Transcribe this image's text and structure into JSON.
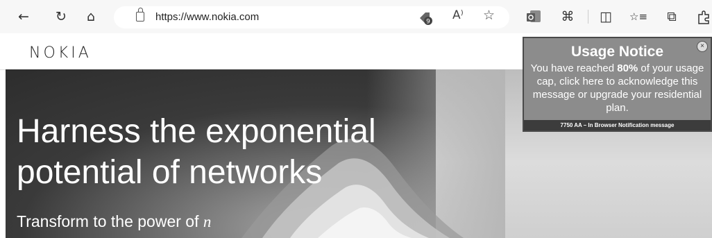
{
  "browser": {
    "url": "https://www.nokia.com",
    "icons": [
      "back-arrow-icon",
      "refresh-icon",
      "home-icon",
      "site-info-icon",
      "extension-icon",
      "read-aloud-icon",
      "favorite-star-icon",
      "outlook-icon",
      "copilot-icon",
      "split-screen-icon",
      "favorites-icon",
      "collections-icon",
      "extensions-icon"
    ],
    "extension_badge": "9",
    "read_aloud_label": "A⁾",
    "glyphs": {
      "back": "←",
      "refresh": "↻",
      "home": "⌂",
      "star": "☆",
      "split": "◫",
      "favorites": "☆≡",
      "collections": "⧉",
      "copilot": "⌘"
    }
  },
  "site": {
    "logo": "NOKIA",
    "headline_line1": "Harness the exponential",
    "headline_line2": "potential of networks",
    "subtitle_prefix": "Transform to the power of ",
    "subtitle_italic": "n"
  },
  "notice": {
    "title": "Usage Notice",
    "body_before": "You have reached ",
    "body_bold": "80%",
    "body_after": " of your usage cap, click here to acknowledge this message or upgrade your residential plan.",
    "footer": "7750 AA – In Browser Notification message",
    "close": "×"
  },
  "colors": {
    "toolbar": "#f7f7f7",
    "notice_bg": "#8c8c8c",
    "notice_footer": "#3c3c3c",
    "hero_dark": "#2a2a2a"
  }
}
